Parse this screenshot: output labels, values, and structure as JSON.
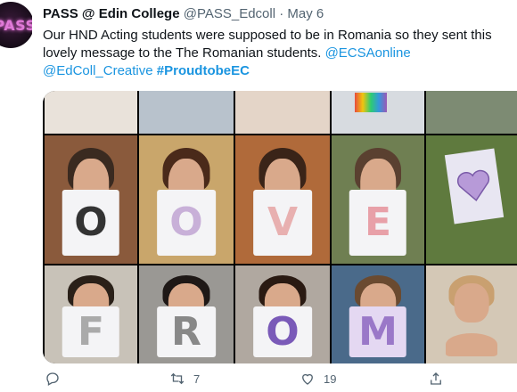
{
  "tweet": {
    "display_name": "PASS @ Edin College",
    "handle": "@PASS_Edcoll",
    "separator": "·",
    "date": "May 6",
    "text_part1": "Our HND Acting students were supposed to be in Romania so they sent this lovely message to the The Romanian students. ",
    "mention1": "@ECSAonline",
    "mention2": "@EdColl_Creative",
    "hashtag": "#ProudtobeEC",
    "avatar_text": "PASS"
  },
  "actions": {
    "retweet_count": "7",
    "like_count": "19"
  },
  "media": {
    "letters": [
      "",
      "",
      "",
      "",
      "",
      "O",
      "V",
      "E",
      "",
      "",
      "F",
      "R",
      "O",
      "M",
      ""
    ]
  },
  "icons": [
    "reply-icon",
    "retweet-icon",
    "like-icon",
    "share-icon"
  ]
}
